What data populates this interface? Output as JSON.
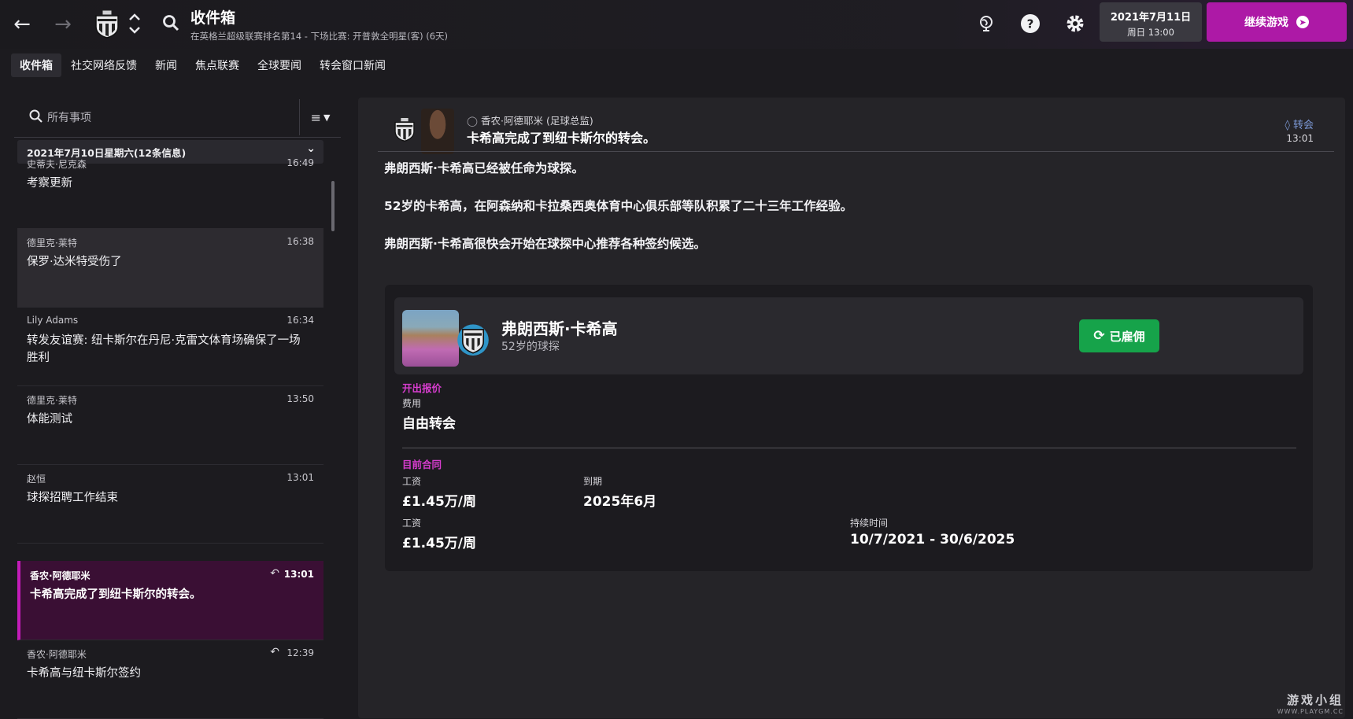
{
  "header": {
    "title": "收件箱",
    "subtitle": "在英格兰超级联赛排名第14 - 下场比赛: 开普敦全明星(客) (6天)",
    "date": "2021年7月11日",
    "time": "周日 13:00",
    "continue_label": "继续游戏",
    "icons": [
      "back-arrow-icon",
      "forward-arrow-icon",
      "club-crest-icon",
      "up-down-chevron-icon",
      "search-icon",
      "globe-icon",
      "help-icon",
      "gear-icon"
    ]
  },
  "tabs": [
    {
      "label": "收件箱",
      "active": true
    },
    {
      "label": "社交网络反馈",
      "active": false
    },
    {
      "label": "新闻",
      "active": false
    },
    {
      "label": "焦点联赛",
      "active": false
    },
    {
      "label": "全球要闻",
      "active": false
    },
    {
      "label": "转会窗口新闻",
      "active": false
    }
  ],
  "sidebar": {
    "search_placeholder": "所有事项",
    "group_header": "2021年7月10日星期六(12条信息)",
    "messages": [
      {
        "sender": "史蒂夫·尼克森",
        "time": "16:49",
        "subject": "考察更新",
        "read": false,
        "selected": false,
        "reply": false
      },
      {
        "sender": "德里克·莱特",
        "time": "16:38",
        "subject": "保罗·达米特受伤了",
        "read": true,
        "selected": false,
        "reply": false
      },
      {
        "sender": "Lily Adams",
        "time": "16:34",
        "subject": "转发友谊赛: 纽卡斯尔在丹尼·克雷文体育场确保了一场胜利",
        "read": false,
        "selected": false,
        "reply": false
      },
      {
        "sender": "德里克·莱特",
        "time": "13:50",
        "subject": "体能测试",
        "read": false,
        "selected": false,
        "reply": false
      },
      {
        "sender": "赵恒",
        "time": "13:01",
        "subject": "球探招聘工作结束",
        "read": false,
        "selected": false,
        "reply": false
      },
      {
        "sender": "香农·阿德耶米",
        "time": "13:01",
        "subject": "卡希高完成了到纽卡斯尔的转会。",
        "read": false,
        "selected": true,
        "reply": true
      },
      {
        "sender": "香农·阿德耶米",
        "time": "12:39",
        "subject": "卡希高与纽卡斯尔签约",
        "read": false,
        "selected": false,
        "reply": true
      }
    ]
  },
  "message": {
    "from": "香农·阿德耶米 (足球总监)",
    "subject": "卡希高完成了到纽卡斯尔的转会。",
    "tag": "转会",
    "time": "13:01",
    "paragraphs": [
      "弗朗西斯·卡希高已经被任命为球探。",
      "52岁的卡希高，在阿森纳和卡拉桑西奥体育中心俱乐部等队积累了二十三年工作经验。",
      "弗朗西斯·卡希高很快会开始在球探中心推荐各种签约候选。"
    ],
    "card": {
      "name": "弗朗西斯·卡希高",
      "role": "52岁的球探",
      "hired_label": "已雇佣",
      "offer_title": "开出报价",
      "fee_label": "费用",
      "fee_value": "自由转会",
      "contract_title": "目前合同",
      "wage_label_1": "工资",
      "wage_value_1": "£1.45万/周",
      "expiry_label": "到期",
      "expiry_value": "2025年6月",
      "wage_label_2": "工资",
      "wage_value_2": "£1.45万/周",
      "duration_label": "持续时间",
      "duration_value": "10/7/2021 - 30/6/2025"
    }
  },
  "watermark": {
    "main": "游戏小组",
    "sub": "WWW.PLAYGM.CC"
  },
  "colors": {
    "accent": "#ad19a6",
    "selected_bg": "#3a0f34",
    "hired_green": "#16a34a",
    "section_pink": "#d73dce",
    "tag_blue": "#7d9ad8"
  }
}
